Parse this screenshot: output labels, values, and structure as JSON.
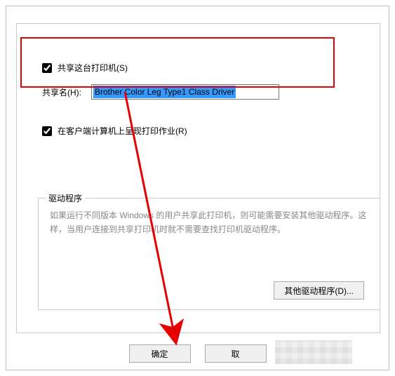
{
  "share": {
    "checkbox_label": "共享这台打印机(S)",
    "checked": true,
    "name_label": "共享名(H):",
    "name_value": "Brother Color Leg Type1 Class Driver"
  },
  "render": {
    "checkbox_label": "在客户端计算机上呈现打印作业(R)",
    "checked": true
  },
  "drivers": {
    "group_title": "驱动程序",
    "group_text": "如果运行不同版本 Windows 的用户共享此打印机，则可能需要安装其他驱动程序。这样，当用户连接到共享打印机时就不需要查找打印机驱动程序。",
    "other_button": "其他驱动程序(D)..."
  },
  "buttons": {
    "ok": "确定",
    "cancel": "取"
  }
}
